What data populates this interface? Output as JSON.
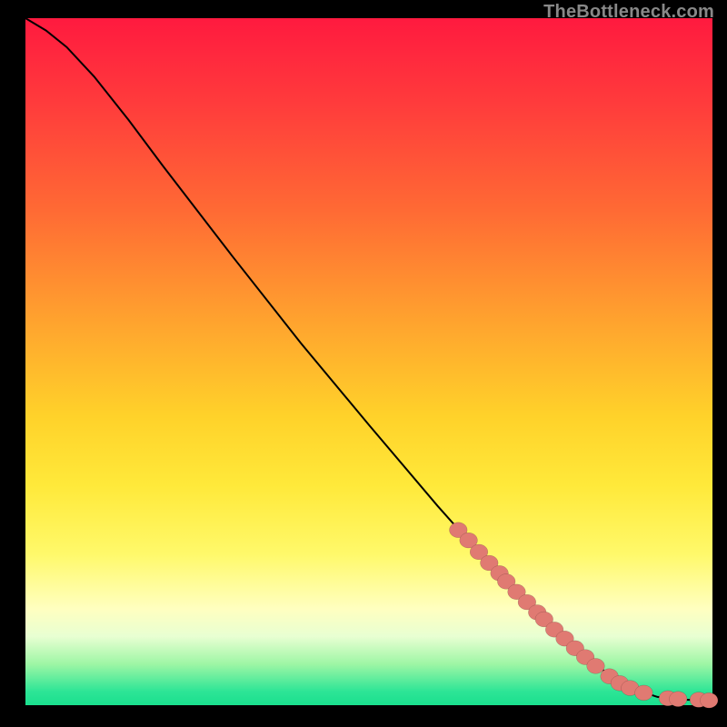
{
  "watermark": "TheBottleneck.com",
  "colors": {
    "gradient_top": "#ff1a3f",
    "gradient_bottom": "#1adf8e",
    "curve": "#000000",
    "marker": "#e07a72",
    "frame": "#000000"
  },
  "chart_data": {
    "type": "line",
    "title": "",
    "xlabel": "",
    "ylabel": "",
    "xlim": [
      0,
      100
    ],
    "ylim": [
      0,
      100
    ],
    "grid": false,
    "legend": false,
    "curve": [
      {
        "x": 0.0,
        "y": 100.0
      },
      {
        "x": 3.0,
        "y": 98.2
      },
      {
        "x": 6.0,
        "y": 95.8
      },
      {
        "x": 10.0,
        "y": 91.5
      },
      {
        "x": 15.0,
        "y": 85.2
      },
      {
        "x": 20.0,
        "y": 78.5
      },
      {
        "x": 30.0,
        "y": 65.5
      },
      {
        "x": 40.0,
        "y": 52.8
      },
      {
        "x": 50.0,
        "y": 40.8
      },
      {
        "x": 60.0,
        "y": 29.0
      },
      {
        "x": 64.0,
        "y": 24.5
      },
      {
        "x": 70.0,
        "y": 18.0
      },
      {
        "x": 76.0,
        "y": 12.0
      },
      {
        "x": 82.0,
        "y": 6.5
      },
      {
        "x": 88.0,
        "y": 2.5
      },
      {
        "x": 92.0,
        "y": 1.2
      },
      {
        "x": 96.0,
        "y": 0.8
      },
      {
        "x": 99.5,
        "y": 0.7
      }
    ],
    "markers": [
      {
        "x": 63.0,
        "y": 25.5
      },
      {
        "x": 64.5,
        "y": 24.0
      },
      {
        "x": 66.0,
        "y": 22.3
      },
      {
        "x": 67.5,
        "y": 20.7
      },
      {
        "x": 69.0,
        "y": 19.2
      },
      {
        "x": 70.0,
        "y": 18.0
      },
      {
        "x": 71.5,
        "y": 16.5
      },
      {
        "x": 73.0,
        "y": 15.0
      },
      {
        "x": 74.5,
        "y": 13.5
      },
      {
        "x": 75.5,
        "y": 12.5
      },
      {
        "x": 77.0,
        "y": 11.0
      },
      {
        "x": 78.5,
        "y": 9.7
      },
      {
        "x": 80.0,
        "y": 8.3
      },
      {
        "x": 81.5,
        "y": 7.0
      },
      {
        "x": 83.0,
        "y": 5.7
      },
      {
        "x": 85.0,
        "y": 4.2
      },
      {
        "x": 86.5,
        "y": 3.2
      },
      {
        "x": 88.0,
        "y": 2.5
      },
      {
        "x": 90.0,
        "y": 1.8
      },
      {
        "x": 93.5,
        "y": 1.0
      },
      {
        "x": 95.0,
        "y": 0.9
      },
      {
        "x": 98.0,
        "y": 0.8
      },
      {
        "x": 99.5,
        "y": 0.7
      }
    ],
    "marker_radius_pct": 1.3
  }
}
